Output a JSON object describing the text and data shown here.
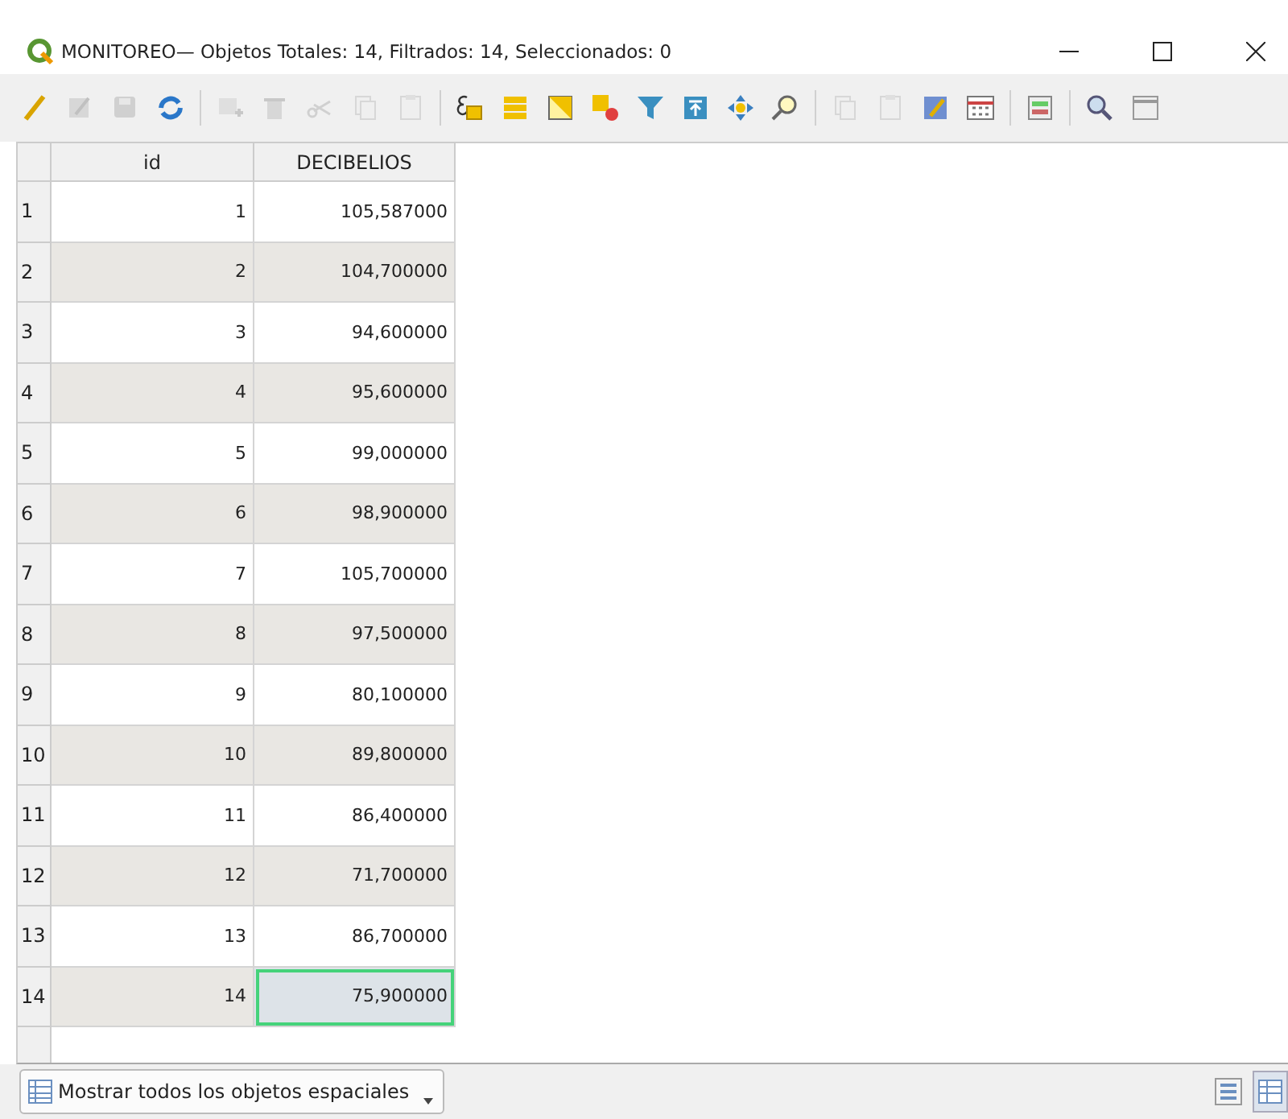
{
  "window": {
    "title": "MONITOREO— Objetos Totales: 14, Filtrados: 14, Seleccionados: 0"
  },
  "toolbar": [
    {
      "kind": "pencil",
      "disabled": false
    },
    {
      "kind": "save-edits",
      "disabled": true
    },
    {
      "kind": "save",
      "disabled": true
    },
    {
      "kind": "reload",
      "disabled": false
    },
    {
      "kind": "sep"
    },
    {
      "kind": "add",
      "disabled": true
    },
    {
      "kind": "delete",
      "disabled": true
    },
    {
      "kind": "cut",
      "disabled": true
    },
    {
      "kind": "copy",
      "disabled": true
    },
    {
      "kind": "paste",
      "disabled": true
    },
    {
      "kind": "sep"
    },
    {
      "kind": "expression",
      "disabled": false
    },
    {
      "kind": "select-all",
      "disabled": false
    },
    {
      "kind": "invert",
      "disabled": false
    },
    {
      "kind": "deselect",
      "disabled": false
    },
    {
      "kind": "filter",
      "disabled": false
    },
    {
      "kind": "move-top",
      "disabled": false
    },
    {
      "kind": "pan",
      "disabled": false
    },
    {
      "kind": "zoom",
      "disabled": false
    },
    {
      "kind": "sep"
    },
    {
      "kind": "copy",
      "disabled": true
    },
    {
      "kind": "paste",
      "disabled": true
    },
    {
      "kind": "edit",
      "disabled": false
    },
    {
      "kind": "calc",
      "disabled": false
    },
    {
      "kind": "sep"
    },
    {
      "kind": "format",
      "disabled": false
    },
    {
      "kind": "sep"
    },
    {
      "kind": "zoom-map",
      "disabled": false
    },
    {
      "kind": "dock",
      "disabled": false
    }
  ],
  "table": {
    "columns": [
      "id",
      "DECIBELIOS"
    ],
    "rows": [
      {
        "header": "1",
        "cells": [
          {
            "text": "1",
            "selected": false
          },
          {
            "text": "105,587000",
            "selected": false
          }
        ]
      },
      {
        "header": "2",
        "cells": [
          {
            "text": "2",
            "selected": false
          },
          {
            "text": "104,700000",
            "selected": false
          }
        ]
      },
      {
        "header": "3",
        "cells": [
          {
            "text": "3",
            "selected": false
          },
          {
            "text": "94,600000",
            "selected": false
          }
        ]
      },
      {
        "header": "4",
        "cells": [
          {
            "text": "4",
            "selected": false
          },
          {
            "text": "95,600000",
            "selected": false
          }
        ]
      },
      {
        "header": "5",
        "cells": [
          {
            "text": "5",
            "selected": false
          },
          {
            "text": "99,000000",
            "selected": false
          }
        ]
      },
      {
        "header": "6",
        "cells": [
          {
            "text": "6",
            "selected": false
          },
          {
            "text": "98,900000",
            "selected": false
          }
        ]
      },
      {
        "header": "7",
        "cells": [
          {
            "text": "7",
            "selected": false
          },
          {
            "text": "105,700000",
            "selected": false
          }
        ]
      },
      {
        "header": "8",
        "cells": [
          {
            "text": "8",
            "selected": false
          },
          {
            "text": "97,500000",
            "selected": false
          }
        ]
      },
      {
        "header": "9",
        "cells": [
          {
            "text": "9",
            "selected": false
          },
          {
            "text": "80,100000",
            "selected": false
          }
        ]
      },
      {
        "header": "10",
        "cells": [
          {
            "text": "10",
            "selected": false
          },
          {
            "text": "89,800000",
            "selected": false
          }
        ]
      },
      {
        "header": "11",
        "cells": [
          {
            "text": "11",
            "selected": false
          },
          {
            "text": "86,400000",
            "selected": false
          }
        ]
      },
      {
        "header": "12",
        "cells": [
          {
            "text": "12",
            "selected": false
          },
          {
            "text": "71,700000",
            "selected": false
          }
        ]
      },
      {
        "header": "13",
        "cells": [
          {
            "text": "13",
            "selected": false
          },
          {
            "text": "86,700000",
            "selected": false
          }
        ]
      },
      {
        "header": "14",
        "cells": [
          {
            "text": "14",
            "selected": false
          },
          {
            "text": "75,900000",
            "selected": true
          }
        ]
      }
    ]
  },
  "bottom_bar": {
    "filter_button": "Mostrar todos los objetos espaciales"
  }
}
